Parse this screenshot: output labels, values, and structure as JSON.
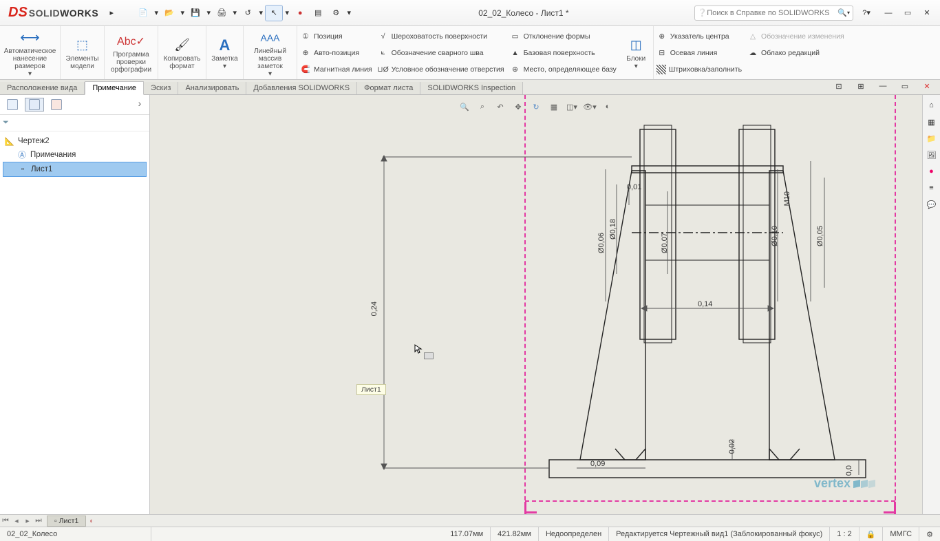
{
  "app": {
    "logo_ds": "DS",
    "logo_name_light": "SOLID",
    "logo_name_bold": "WORKS"
  },
  "titlebar": {
    "document_title": "02_02_Колесо - Лист1 *",
    "search_placeholder": "Поиск в Справке по SOLIDWORKS",
    "help_symbol": "?"
  },
  "ribbon": {
    "auto_dimension": "Автоматическое нанесение размеров",
    "model_items": "Элементы модели",
    "spellcheck": "Программа проверки орфографии",
    "copy_format": "Копировать формат",
    "note": "Заметка",
    "note_array": "Линейный массив заметок",
    "position": "Позиция",
    "auto_position": "Авто-позиция",
    "magnetic_line": "Магнитная линия",
    "surface_roughness": "Шероховатость поверхности",
    "weld_symbol": "Обозначение сварного шва",
    "hole_callout": "Условное обозначение отверстия",
    "form_deviation": "Отклонение формы",
    "datum_surface": "Базовая поверхность",
    "datum_target": "Место, определяющее базу",
    "blocks": "Блоки",
    "center_mark": "Указатель центра",
    "centerline": "Осевая линия",
    "hatch_fill": "Штриховка/заполнить",
    "change_symbol": "Обозначение изменения",
    "revision_cloud": "Облако редакций"
  },
  "tabs": {
    "t1": "Расположение вида",
    "t2": "Примечание",
    "t3": "Эскиз",
    "t4": "Анализировать",
    "t5": "Добавления SOLIDWORKS",
    "t6": "Формат листа",
    "t7": "SOLIDWORKS Inspection"
  },
  "tree": {
    "root": "Чертеж2",
    "annotations": "Примечания",
    "sheet": "Лист1"
  },
  "canvas": {
    "tooltip": "Лист1",
    "dims": {
      "d024": "0,24",
      "d014": "0,14",
      "d009": "0,09",
      "d001": "0,01",
      "d002": "0,02",
      "d00": "0,0",
      "phi018": "Ø0,18",
      "phi006": "Ø0,06",
      "phi007": "Ø0,07",
      "phi010": "Ø0,10",
      "phi005": "Ø0,05",
      "m10": "M10"
    }
  },
  "sheet_tabs": {
    "sheet1": "Лист1"
  },
  "status": {
    "model": "02_02_Колесо",
    "x": "117.07мм",
    "y": "421.82мм",
    "def": "Недоопределен",
    "state": "Редактируется Чертежный вид1 (Заблокированный фокус)",
    "scale": "1 : 2",
    "units": "ММГС"
  },
  "watermark": "vertex"
}
